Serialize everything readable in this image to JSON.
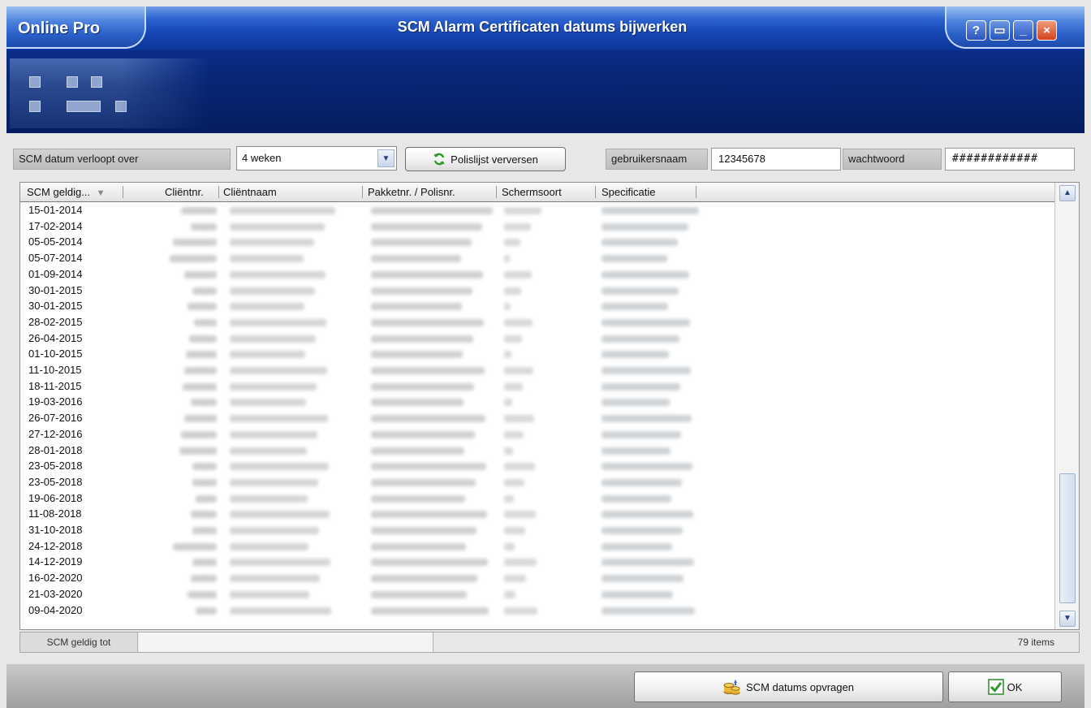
{
  "window": {
    "app_name": "Online Pro",
    "title": "SCM Alarm Certificaten datums bijwerken",
    "buttons": {
      "help": "?",
      "restore": "▭",
      "minimize": "_",
      "close": "×"
    }
  },
  "toolbar": {
    "expires_label": "SCM datum verloopt over",
    "expires_value": "4 weken",
    "refresh_button": "Polislijst verversen",
    "username_label": "gebruikersnaam",
    "username_value": "12345678",
    "password_label": "wachtwoord",
    "password_value": "############"
  },
  "table": {
    "columns": [
      "SCM geldig...",
      "Cliëntnr.",
      "Cliëntnaam",
      "Pakketnr. / Polisnr.",
      "Schermsoort",
      "Specificatie"
    ],
    "dates": [
      "15-01-2014",
      "17-02-2014",
      "05-05-2014",
      "05-07-2014",
      "01-09-2014",
      "30-01-2015",
      "30-01-2015",
      "28-02-2015",
      "26-04-2015",
      "01-10-2015",
      "11-10-2015",
      "18-11-2015",
      "19-03-2016",
      "26-07-2016",
      "27-12-2016",
      "28-01-2018",
      "23-05-2018",
      "23-05-2018",
      "19-06-2018",
      "11-08-2018",
      "31-10-2018",
      "24-12-2018",
      "14-12-2019",
      "16-02-2020",
      "21-03-2020",
      "09-04-2020"
    ]
  },
  "status": {
    "column_label": "SCM geldig tot",
    "count": "79 items"
  },
  "footer": {
    "request_button": "SCM datums opvragen",
    "ok_button": "OK"
  },
  "colors": {
    "header_dark": "#061d60",
    "header_light": "#2c63cf",
    "close_red": "#d2421e"
  }
}
